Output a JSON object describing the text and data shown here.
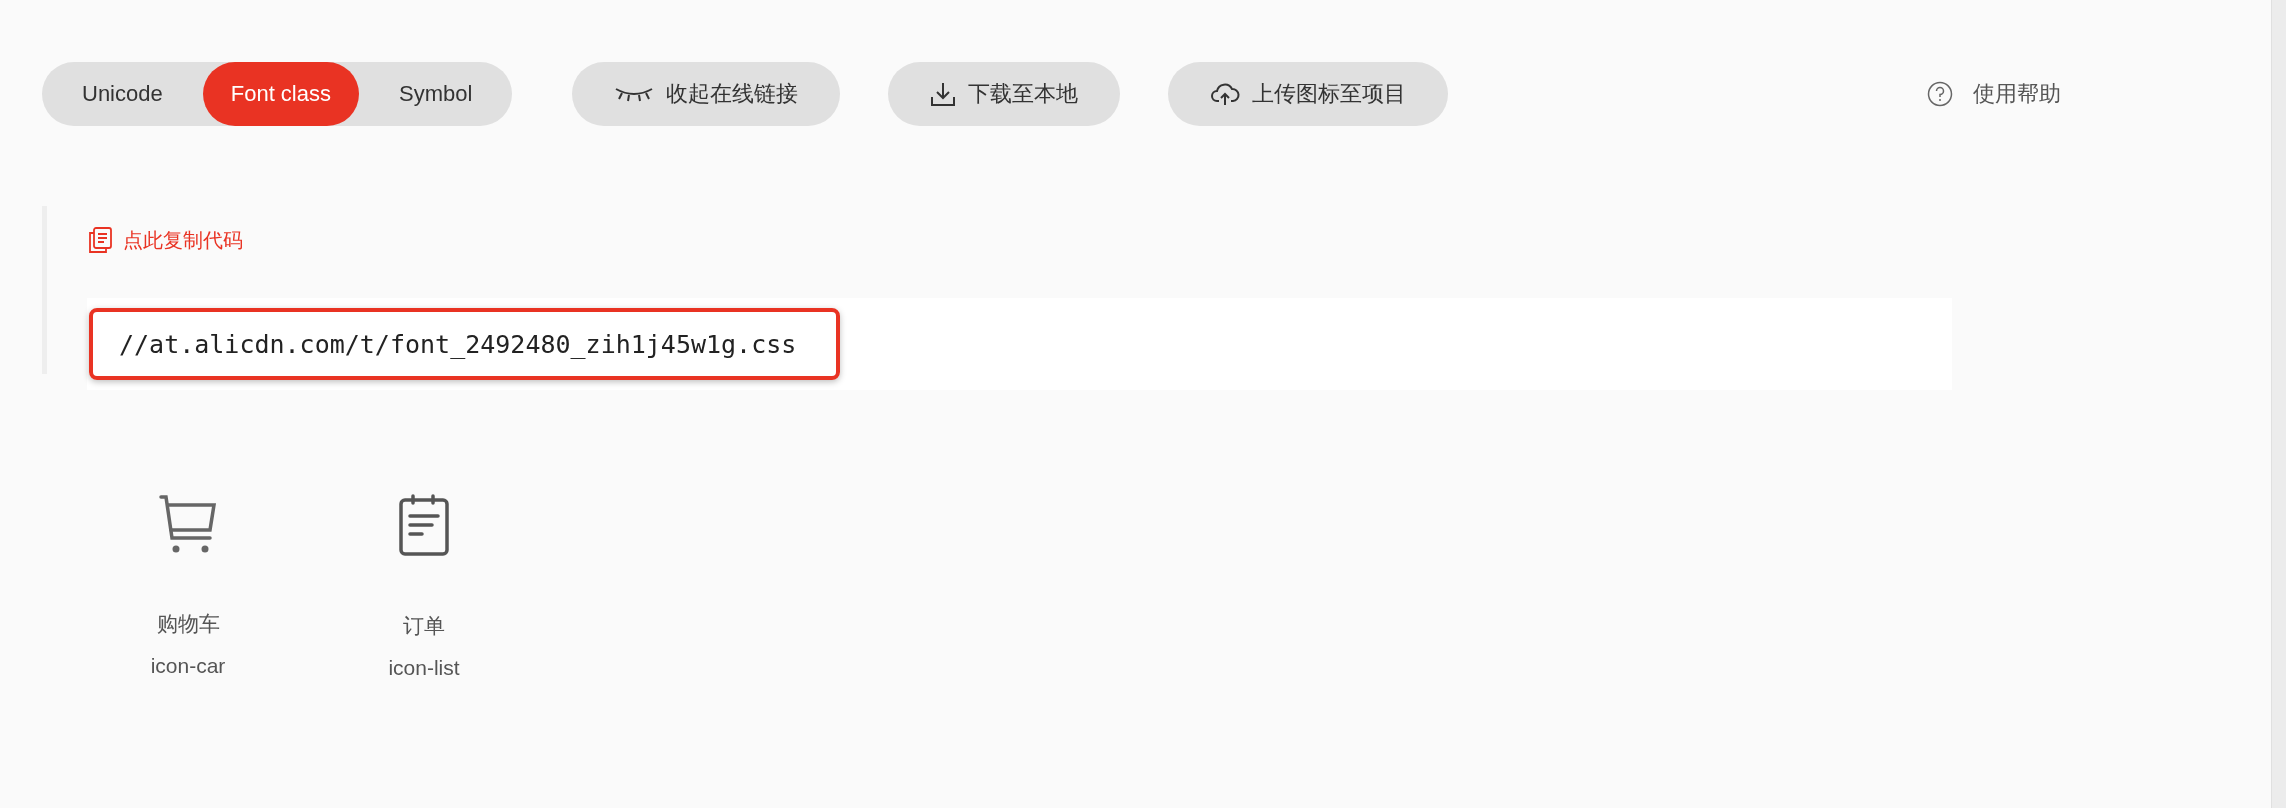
{
  "tabs": [
    {
      "label": "Unicode",
      "selected": false
    },
    {
      "label": "Font class",
      "selected": true
    },
    {
      "label": "Symbol",
      "selected": false
    }
  ],
  "actions": [
    {
      "kind": "eye",
      "label": "收起在线链接"
    },
    {
      "kind": "download",
      "label": "下载至本地"
    },
    {
      "kind": "upload",
      "label": "上传图标至项目"
    }
  ],
  "help": {
    "label": "使用帮助"
  },
  "code_panel": {
    "copy_label": "点此复制代码",
    "url": "//at.alicdn.com/t/font_2492480_zih1j45w1g.css"
  },
  "icons": [
    {
      "kind": "cart",
      "name": "购物车",
      "class_name": "icon-car"
    },
    {
      "kind": "list",
      "name": "订单",
      "class_name": "icon-list"
    }
  ]
}
